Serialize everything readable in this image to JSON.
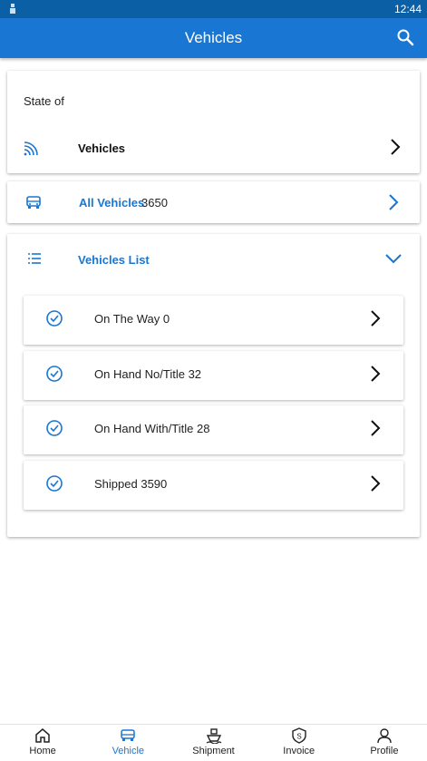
{
  "status_bar": {
    "time": "12:44"
  },
  "app_bar": {
    "title": "Vehicles"
  },
  "state_card": {
    "label": "State of",
    "row_label": "Vehicles"
  },
  "all_vehicles": {
    "label": "All Vehicles",
    "count": "3650"
  },
  "vehicles_list": {
    "label": "Vehicles List",
    "items": [
      {
        "label": "On The Way",
        "count": "0"
      },
      {
        "label": "On Hand No/Title",
        "count": "32"
      },
      {
        "label": "On Hand With/Title",
        "count": "28"
      },
      {
        "label": "Shipped",
        "count": "3590"
      }
    ]
  },
  "bottom_nav": [
    {
      "label": "Home",
      "icon": "home-icon",
      "active": false
    },
    {
      "label": "Vehicle",
      "icon": "car-icon",
      "active": true
    },
    {
      "label": "Shipment",
      "icon": "ship-icon",
      "active": false
    },
    {
      "label": "Invoice",
      "icon": "invoice-icon",
      "active": false
    },
    {
      "label": "Profile",
      "icon": "profile-icon",
      "active": false
    }
  ],
  "colors": {
    "primary": "#1976d2",
    "status_bar": "#0b5fa5",
    "text": "#222222"
  }
}
